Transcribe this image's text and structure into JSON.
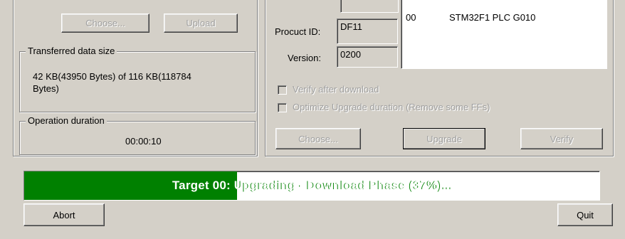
{
  "left_panel": {
    "choose_button": "Choose...",
    "upload_button": "Upload",
    "transferred": {
      "legend": "Transferred data size",
      "line1": "42 KB(43950 Bytes) of 116 KB(118784",
      "line2": "Bytes)"
    },
    "duration": {
      "legend": "Operation duration",
      "value": "00:00:10"
    }
  },
  "right_panel": {
    "product_id_label": "Procuct ID:",
    "product_id_value": "DF11",
    "version_label": "Version:",
    "version_value": "0200",
    "target_list": [
      {
        "index": "00",
        "name": "STM32F1 PLC G010"
      }
    ],
    "verify_after_download": {
      "label": "Verify after download",
      "checked": false
    },
    "optimize_upgrade": {
      "label": "Optimize Upgrade duration (Remove some FFs)",
      "checked": false
    },
    "choose_button": "Choose...",
    "upgrade_button": "Upgrade",
    "verify_button": "Verify"
  },
  "progress": {
    "text": "Target 00: Upgrading - Download Phase (37%)...",
    "percent": 37,
    "color": "#008000"
  },
  "abort_button": "Abort",
  "quit_button": "Quit"
}
